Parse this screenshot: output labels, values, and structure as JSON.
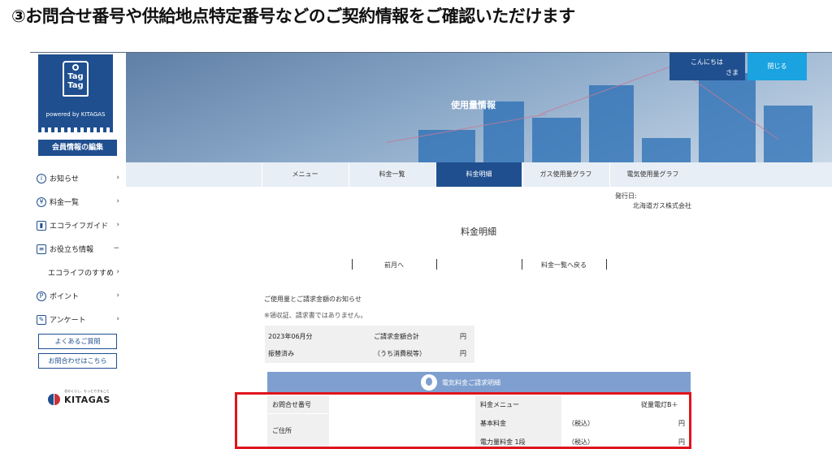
{
  "slide": {
    "title": "③お問合せ番号や供給地点特定番号などのご契約情報をご確認いただけます"
  },
  "sidebar": {
    "logo": {
      "line1": "Tag",
      "line2": "Tag",
      "tagline": "powered by KITAGAS"
    },
    "member_edit": "会員情報の編集",
    "items": [
      {
        "label": "お知らせ",
        "icon": "info-icon"
      },
      {
        "label": "料金一覧",
        "icon": "yen-icon"
      },
      {
        "label": "エコライフガイド",
        "icon": "bar-chart-icon"
      },
      {
        "label": "お役立ち情報",
        "icon": "document-icon"
      },
      {
        "label": "エコライフのすすめ",
        "icon": ""
      },
      {
        "label": "ポイント",
        "icon": "point-icon"
      },
      {
        "label": "アンケート",
        "icon": "survey-icon"
      }
    ],
    "faq": "よくあるご質問",
    "contact": "お問合わせはこちら",
    "brand": {
      "name": "KITAGAS",
      "tagline": "北のくらし、もっとできること"
    }
  },
  "header": {
    "title": "使用量情報",
    "greeting": "こんにちは",
    "honorific": "さま",
    "close": "閉じる"
  },
  "tabs": [
    {
      "label": "メニュー",
      "active": false
    },
    {
      "label": "料金一覧",
      "active": false
    },
    {
      "label": "料金明細",
      "active": true
    },
    {
      "label": "ガス使用量グラフ",
      "active": false
    },
    {
      "label": "電気使用量グラフ",
      "active": false
    }
  ],
  "issued": {
    "label": "発行日:",
    "company": "北海道ガス株式会社"
  },
  "page_title": "料金明細",
  "pager": {
    "prev": "前月へ",
    "back": "料金一覧へ戻る"
  },
  "notice": {
    "heading": "ご使用量とご請求金額のお知らせ",
    "disclaimer": "※領収証、請求書ではありません。"
  },
  "summary": {
    "month": "2023年06月分",
    "total_label": "ご請求金額合計",
    "total_unit": "円",
    "payment": "振替済み",
    "tax_label": "（うち消費税等）",
    "tax_unit": "円"
  },
  "detail": {
    "heading": "電気料金ご請求明細",
    "inquiry_no": "お問合せ番号",
    "address": "ご住所",
    "menu_label": "料金メニュー",
    "menu_value": "従量電灯B＋",
    "base_label": "基本料金",
    "base_tax": "（税込）",
    "base_unit": "円",
    "energy_label": "電力量料金 1段",
    "energy_tax": "（税込）",
    "energy_unit": "円"
  },
  "colors": {
    "brand_navy": "#1f4f8f",
    "accent_blue": "#1aa3e0",
    "highlight_red": "#e0141c"
  }
}
